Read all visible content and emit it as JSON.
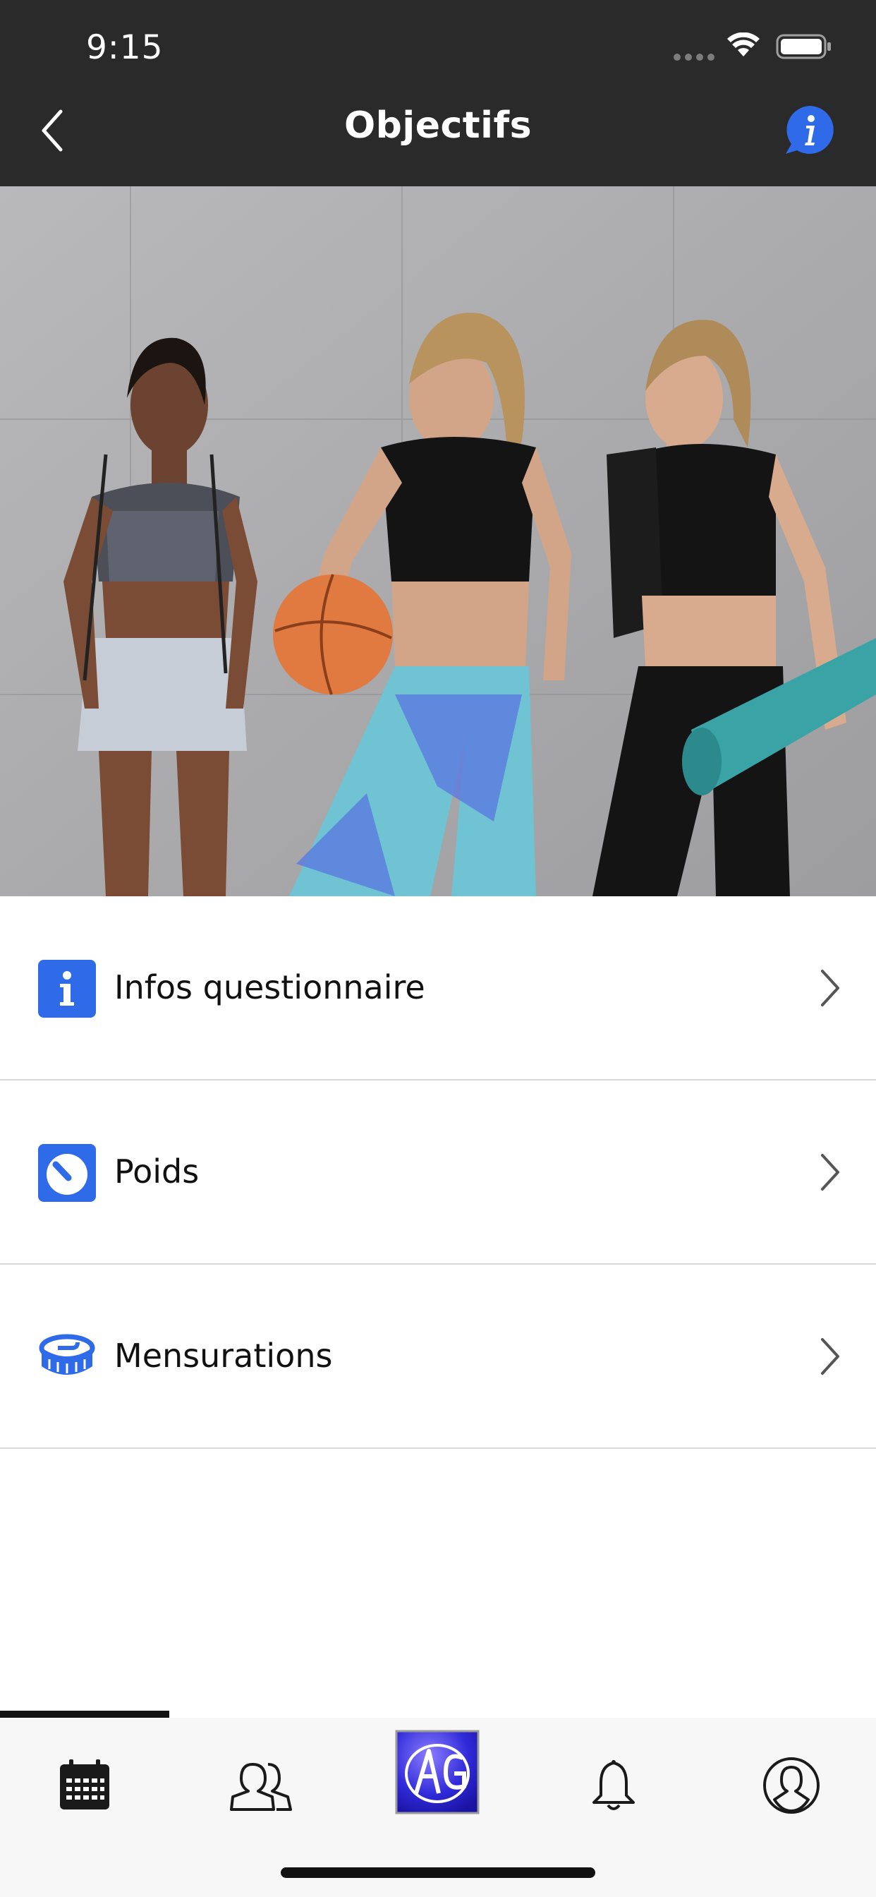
{
  "status_bar": {
    "time": "9:15"
  },
  "nav": {
    "title": "Objectifs",
    "back_icon": "chevron-left-icon",
    "info_icon": "info-bubble-icon"
  },
  "hero": {
    "description_icon": "fitness-photo"
  },
  "list": {
    "items": [
      {
        "label": "Infos questionnaire",
        "icon": "info-square-icon"
      },
      {
        "label": "Poids",
        "icon": "scale-icon"
      },
      {
        "label": "Mensurations",
        "icon": "measuring-tape-icon"
      }
    ]
  },
  "tabbar": {
    "tabs": [
      {
        "icon": "calendar-icon"
      },
      {
        "icon": "group-icon"
      },
      {
        "icon": "app-logo-icon"
      },
      {
        "icon": "bell-icon"
      },
      {
        "icon": "profile-icon"
      }
    ],
    "selected_index": 0
  },
  "colors": {
    "header_bg": "#2a2a2b",
    "accent_blue": "#2f6be8",
    "text_dark": "#111111",
    "divider": "#d8d8d8"
  }
}
